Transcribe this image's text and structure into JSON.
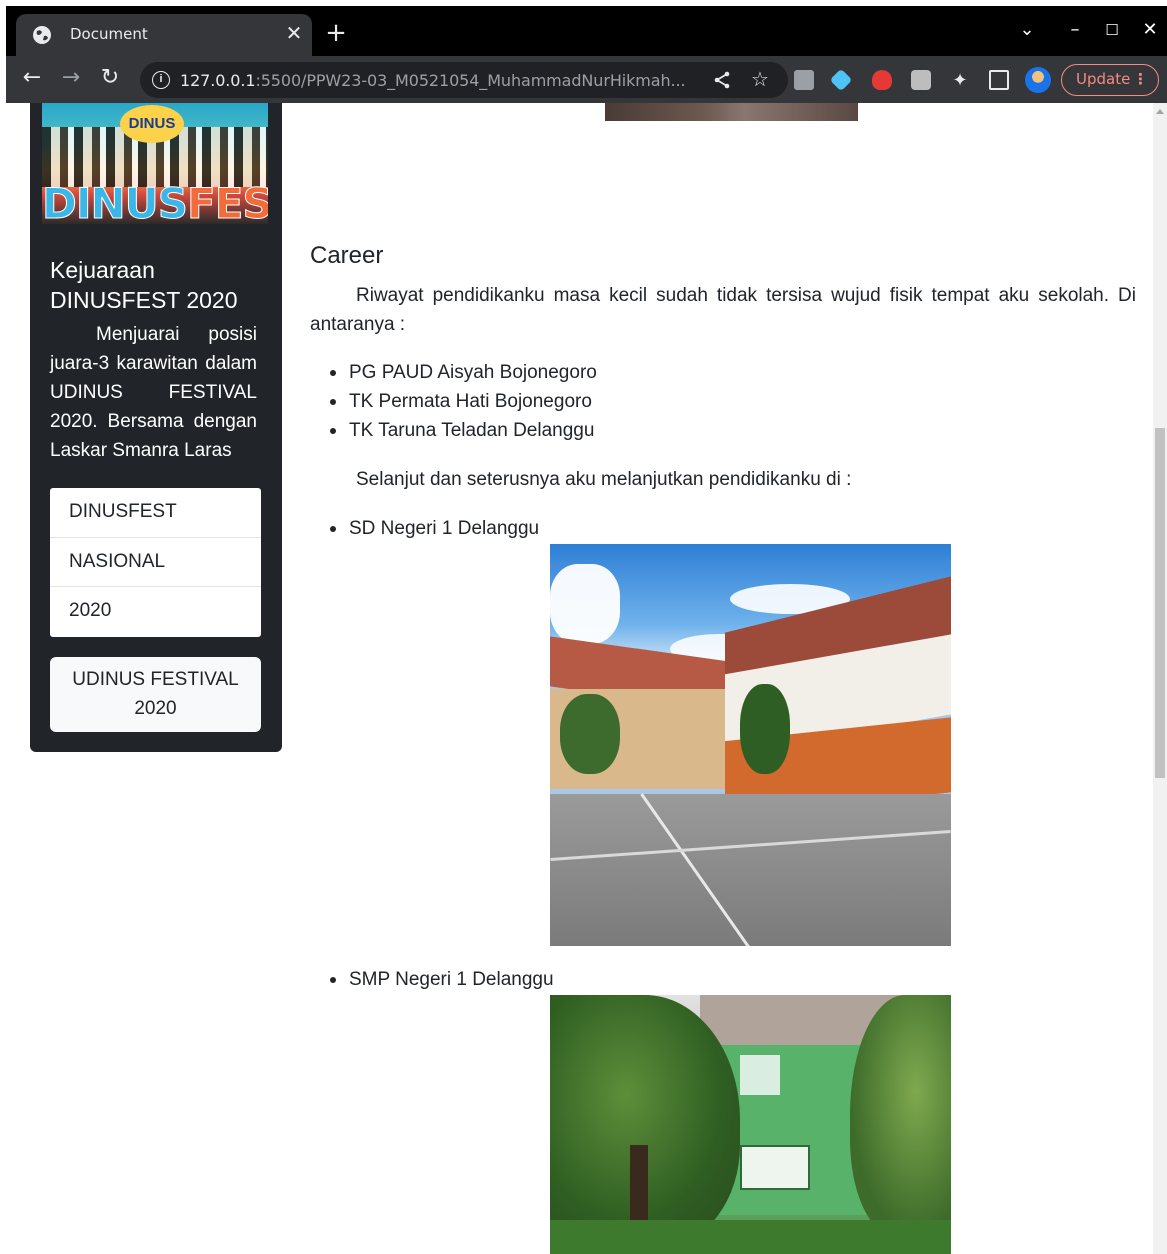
{
  "browser": {
    "tab_title": "Document",
    "url_host": "127.0.0.1",
    "url_rest": ":5500/PPW23-03_M0521054_MuhammadNurHikmah...",
    "update_label": "Update"
  },
  "sidebar": {
    "title": "Kejuaraan DINUSFEST 2020",
    "text": "Menjuarai posisi juara-3 karawitan dalam UDINUS FESTIVAL 2020. Bersama dengan Laskar Smanra Laras",
    "tags": [
      "DINUSFEST",
      "NASIONAL",
      "2020"
    ],
    "button_label": "UDINUS FESTIVAL 2020",
    "image_badge": "DINUS",
    "image_logo_a": "DINUS",
    "image_logo_b": "FEST"
  },
  "main": {
    "heading": "Career",
    "paragraph_1": "Riwayat pendidikanku masa kecil sudah tidak tersisa wujud fisik tempat aku sekolah. Di antaranya :",
    "early_schools": [
      "PG PAUD Aisyah Bojonegoro",
      "TK Permata Hati Bojonegoro",
      "TK Taruna Teladan Delanggu"
    ],
    "paragraph_2": "Selanjut dan seterusnya aku melanjutkan pendidikanku di :",
    "school_sd": "SD Negeri 1 Delanggu",
    "school_smp": "SMP Negeri 1 Delanggu"
  },
  "colors": {
    "sidebar_bg": "#212529",
    "text": "#212529",
    "update_accent": "#f28b82"
  }
}
